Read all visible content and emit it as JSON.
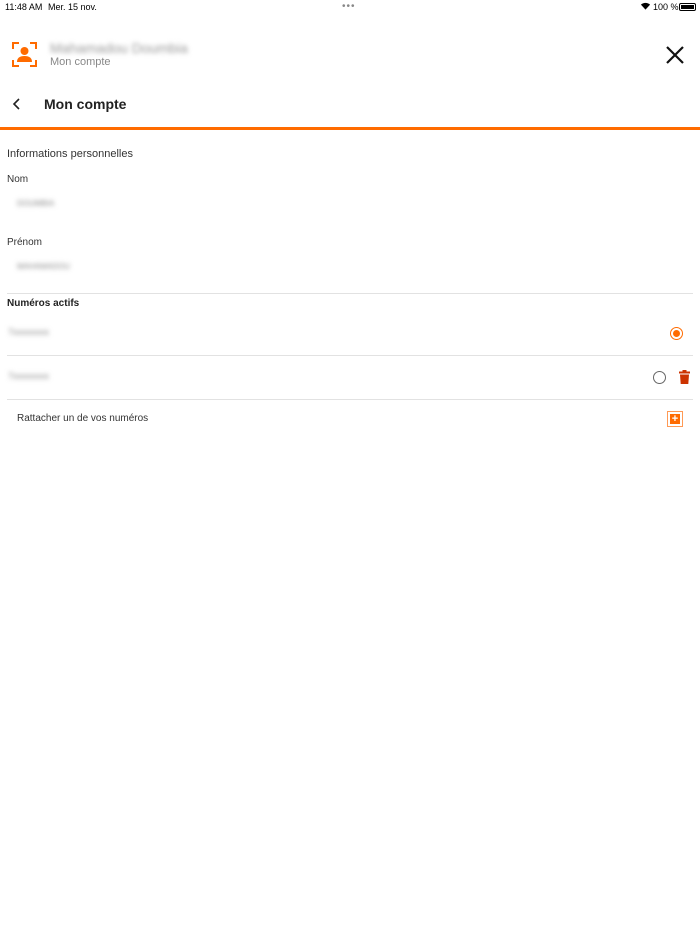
{
  "status_bar": {
    "time": "11:48 AM",
    "date": "Mer. 15 nov.",
    "battery": "100 %"
  },
  "header": {
    "user_name": "Mahamadou Doumbia",
    "subtitle": "Mon compte"
  },
  "nav": {
    "title": "Mon compte"
  },
  "personal": {
    "section_title": "Informations personnelles",
    "nom_label": "Nom",
    "nom_value": "DOUMBIA",
    "prenom_label": "Prénom",
    "prenom_value": "MAHAMADOU"
  },
  "numbers": {
    "section_title": "Numéros actifs",
    "items": [
      {
        "value": "7xxxxxxxx",
        "selected": true
      },
      {
        "value": "7xxxxxxxx",
        "selected": false
      }
    ],
    "attach_label": "Rattacher un de vos numéros"
  },
  "colors": {
    "accent": "#ff6b00",
    "delete": "#cc3300"
  }
}
